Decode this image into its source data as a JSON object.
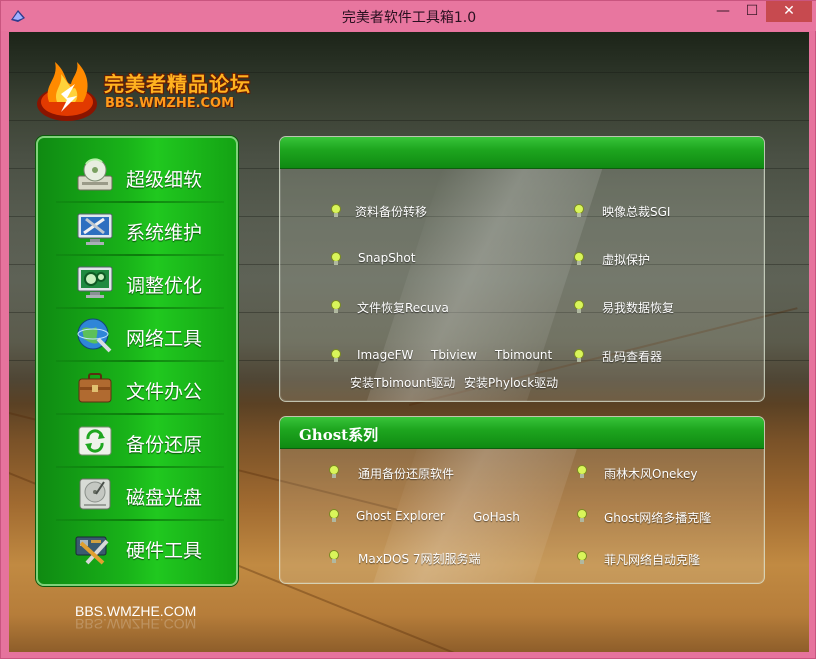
{
  "window": {
    "title": "完美者软件工具箱1.0",
    "min_glyph": "—",
    "max_glyph": "☐",
    "close_glyph": "✕"
  },
  "logo": {
    "main": "完美者精品论坛",
    "sub": "BBS.WMZHE.COM"
  },
  "nav": {
    "items": [
      {
        "label": "超级细软",
        "icon": "disc-drive-icon"
      },
      {
        "label": "系统维护",
        "icon": "monitor-tools-icon"
      },
      {
        "label": "调整优化",
        "icon": "monitor-gears-icon"
      },
      {
        "label": "网络工具",
        "icon": "globe-network-icon"
      },
      {
        "label": "文件办公",
        "icon": "briefcase-icon"
      },
      {
        "label": "备份还原",
        "icon": "backup-drive-icon"
      },
      {
        "label": "磁盘光盘",
        "icon": "hard-disk-icon"
      },
      {
        "label": "硬件工具",
        "icon": "hardware-tools-icon"
      }
    ]
  },
  "footer": {
    "url": "BBS.WMZHE.COM"
  },
  "panel1": {
    "title": "",
    "tools": [
      "资料备份转移",
      "映像总裁SGI",
      "SnapShot",
      "虚拟保护",
      "文件恢复Recuva",
      "易我数据恢复",
      "ImageFW",
      "Tbiview",
      "Tbimount",
      "乱码查看器",
      "安装Tbimount驱动",
      "安装Phylock驱动"
    ]
  },
  "panel2": {
    "title": "Ghost系列",
    "tools": [
      "通用备份还原软件",
      "雨林木风Onekey",
      "Ghost Explorer",
      "GoHash",
      "Ghost网络多播克隆",
      "MaxDOS 7网刻服务端",
      "菲凡网络自动克隆"
    ]
  },
  "colors": {
    "title_bar": "#e8769f",
    "nav_green": "#19b319",
    "header_green": "#1ea61f",
    "bulb": "#d9f55a"
  }
}
